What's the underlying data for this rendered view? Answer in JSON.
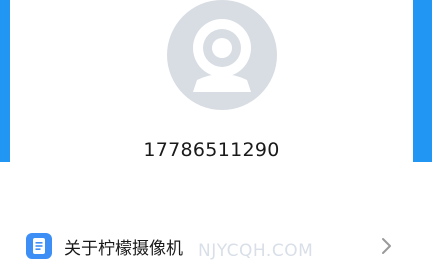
{
  "profile": {
    "avatar_icon": "webcam-icon",
    "phone_number": "17786511290"
  },
  "menu": {
    "about": {
      "icon": "document-icon",
      "label": "关于柠檬摄像机",
      "trailing_icon": "chevron-right-icon"
    }
  },
  "watermark": "NJYCQH.COM",
  "colors": {
    "header_blue": "#2196f3",
    "icon_blue": "#3d8ff5",
    "avatar_bg": "#d8dde4",
    "avatar_fg": "#ffffff"
  }
}
